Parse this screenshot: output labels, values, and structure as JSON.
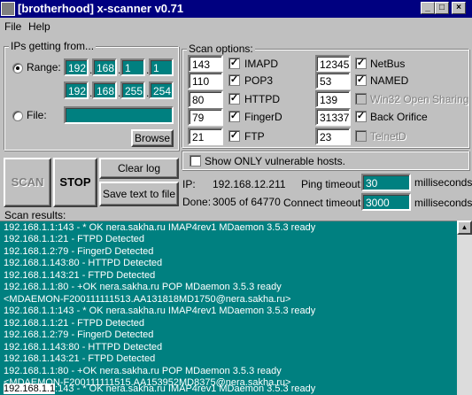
{
  "window": {
    "title": "[brotherhood] x-scanner v0.71",
    "controls": [
      "_",
      "□",
      "×"
    ]
  },
  "menu": [
    "File",
    "Help"
  ],
  "ips": {
    "legend": "IPs getting from...",
    "range_label": "Range:",
    "file_label": "File:",
    "range_from": [
      "192",
      "168",
      "1",
      "1"
    ],
    "range_to": [
      "192",
      "168",
      "255",
      "254"
    ],
    "file_value": "",
    "browse_label": "Browse"
  },
  "scan_options": {
    "legend": "Scan options:",
    "left": [
      {
        "port": "143",
        "checked": true,
        "label": "IMAPD"
      },
      {
        "port": "110",
        "checked": true,
        "label": "POP3"
      },
      {
        "port": "80",
        "checked": true,
        "label": "HTTPD"
      },
      {
        "port": "79",
        "checked": true,
        "label": "FingerD"
      },
      {
        "port": "21",
        "checked": true,
        "label": "FTP"
      }
    ],
    "right": [
      {
        "port": "12345",
        "checked": true,
        "label": "NetBus",
        "disabled": false
      },
      {
        "port": "53",
        "checked": true,
        "label": "NAMED",
        "disabled": false
      },
      {
        "port": "139",
        "checked": false,
        "label": "Win32 Open Sharing",
        "disabled": true
      },
      {
        "port": "31337",
        "checked": true,
        "label": "Back Orifice",
        "disabled": false
      },
      {
        "port": "23",
        "checked": false,
        "label": "TelnetD",
        "disabled": true
      }
    ],
    "show_vulnerable_label": "Show ONLY vulnerable hosts."
  },
  "buttons": {
    "scan": "SCAN",
    "stop": "STOP",
    "clear_log": "Clear log",
    "save_text": "Save text to file"
  },
  "status": {
    "ip_label": "IP:",
    "ip_value": "192.168.12.211",
    "done_label": "Done:",
    "done_value": "3005 of 64770",
    "ping_timeout_label": "Ping timeout:",
    "ping_timeout_value": "30",
    "connect_timeout_label": "Connect timeout:",
    "connect_timeout_value": "3000",
    "ms_unit": "milliseconds"
  },
  "results": {
    "label": "Scan results:",
    "lines": [
      "192.168.1.1:143 - * OK nera.sakha.ru IMAP4rev1 MDaemon 3.5.3 ready",
      "192.168.1.1:21 - FTPD Detected",
      "192.168.1.2:79 - FingerD Detected",
      "192.168.1.143:80 - HTTPD Detected",
      "192.168.1.143:21 - FTPD Detected",
      "192.168.1.1:80 - +OK nera.sakha.ru POP MDaemon 3.5.3 ready",
      "<MDAEMON-F200111111513.AA131818MD1750@nera.sakha.ru>",
      "192.168.1.1:143 - * OK nera.sakha.ru IMAP4rev1 MDaemon 3.5.3 ready",
      "192.168.1.1:21 - FTPD Detected",
      "192.168.1.2:79 - FingerD Detected",
      "192.168.1.143:80 - HTTPD Detected",
      "192.168.1.143:21 - FTPD Detected",
      "192.168.1.1:80 - +OK nera.sakha.ru POP MDaemon 3.5.3 ready",
      "<MDAEMON-F200111111515.AA153952MD8375@nera.sakha.ru>"
    ],
    "last_line_highlight": "192.168.1.1",
    "last_line_rest": ":143 - * OK nera.sakha.ru IMAP4rev1 MDaemon 3.5.3 ready"
  },
  "colors": {
    "titlebar": "#000080",
    "teal": "#008080",
    "face": "#c0c0c0"
  }
}
